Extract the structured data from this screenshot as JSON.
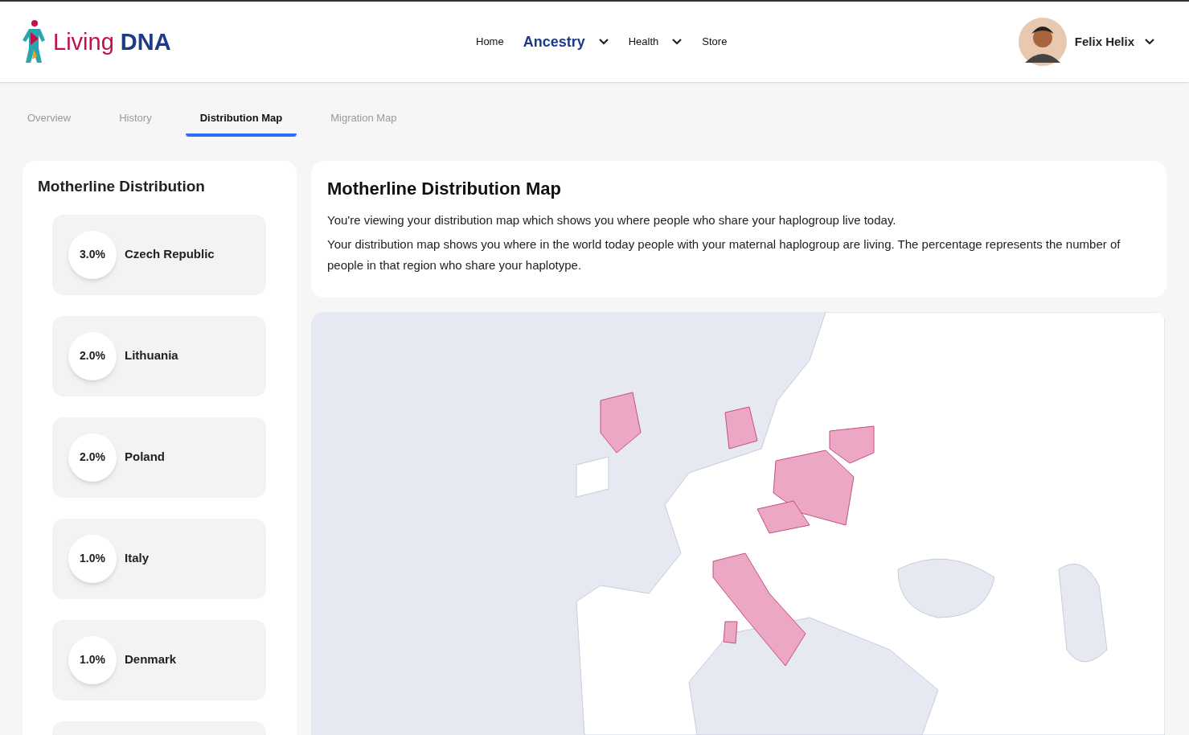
{
  "header": {
    "logo": {
      "word_1": "Living",
      "word_2": "DNA"
    },
    "nav": [
      {
        "label": "Home",
        "selected": false,
        "dropdown": false
      },
      {
        "label": "Ancestry",
        "selected": true,
        "dropdown": true
      },
      {
        "label": "Health",
        "selected": false,
        "dropdown": true
      },
      {
        "label": "Store",
        "selected": false,
        "dropdown": false
      }
    ],
    "user": {
      "name": "Felix Helix"
    }
  },
  "tabs": [
    {
      "label": "Overview",
      "selected": false
    },
    {
      "label": "History",
      "selected": false
    },
    {
      "label": "Distribution Map",
      "selected": true
    },
    {
      "label": "Migration Map",
      "selected": false
    }
  ],
  "sidebar": {
    "title": "Motherline Distribution",
    "items": [
      {
        "percent": "3.0%",
        "region": "Czech Republic"
      },
      {
        "percent": "2.0%",
        "region": "Lithuania"
      },
      {
        "percent": "2.0%",
        "region": "Poland"
      },
      {
        "percent": "1.0%",
        "region": "Italy"
      },
      {
        "percent": "1.0%",
        "region": "Denmark"
      }
    ]
  },
  "info": {
    "title": "Motherline Distribution Map",
    "paragraphs": [
      "You're viewing your distribution map which shows you where people who share your haplogroup live today.",
      "Your distribution map shows you where in the world today people with your maternal haplogroup are living. The percentage represents the number of people in that region who share your haplotype."
    ]
  }
}
